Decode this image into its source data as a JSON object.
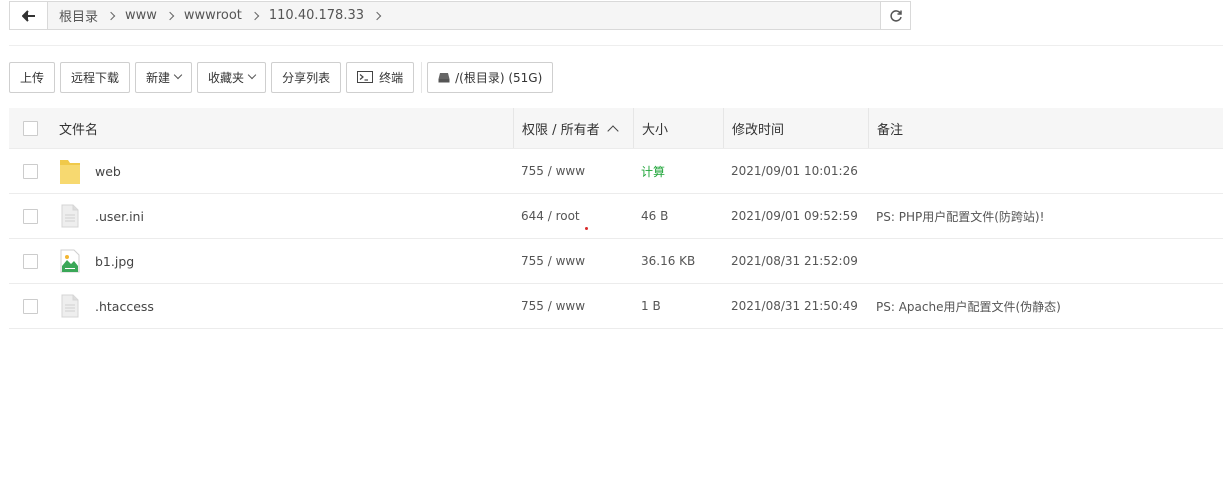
{
  "path": {
    "back_icon": "arrow-left-icon",
    "crumbs": [
      "根目录",
      "www",
      "wwwroot",
      "110.40.178.33"
    ],
    "refresh_icon": "refresh-icon"
  },
  "toolbar": {
    "upload": "上传",
    "remote_download": "远程下载",
    "new": "新建",
    "favorites": "收藏夹",
    "share_list": "分享列表",
    "terminal": "终端",
    "disk": "/(根目录) (51G)"
  },
  "table": {
    "headers": {
      "name": "文件名",
      "perm": "权限 / 所有者",
      "size": "大小",
      "time": "修改时间",
      "note": "备注"
    },
    "rows": [
      {
        "name": "web",
        "icon": "folder-icon",
        "perm": "755 / www",
        "size": "计算",
        "time": "2021/09/01 10:01:26",
        "note": ""
      },
      {
        "name": ".user.ini",
        "icon": "file-icon",
        "perm": "644 / root",
        "size": "46 B",
        "time": "2021/09/01 09:52:59",
        "note": "PS: PHP用户配置文件(防跨站)!"
      },
      {
        "name": "b1.jpg",
        "icon": "image-file-icon",
        "perm": "755 / www",
        "size": "36.16 KB",
        "time": "2021/08/31 21:52:09",
        "note": ""
      },
      {
        "name": ".htaccess",
        "icon": "file-icon",
        "perm": "755 / www",
        "size": "1 B",
        "time": "2021/08/31 21:50:49",
        "note": "PS: Apache用户配置文件(伪静态)"
      }
    ]
  },
  "colors": {
    "accent_green": "#20a53a",
    "header_bg": "#f6f6f6",
    "border": "#d9d9d9"
  }
}
